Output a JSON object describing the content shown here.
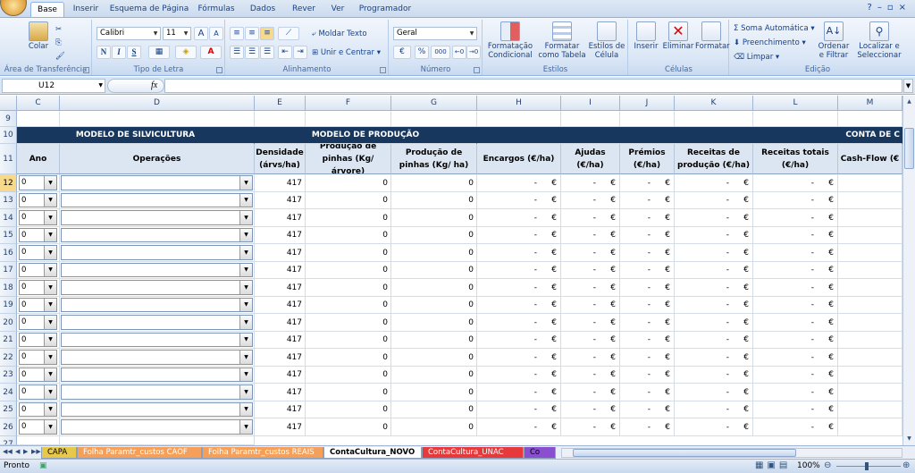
{
  "ribbon_tabs": [
    "Base",
    "Inserir",
    "Esquema de Página",
    "Fórmulas",
    "Dados",
    "Rever",
    "Ver",
    "Programador"
  ],
  "clipboard": {
    "paste_label": "Colar",
    "group_label": "Área de Transferência"
  },
  "font": {
    "name": "Calibri",
    "size": "11",
    "bold": "N",
    "italic": "I",
    "underline": "S",
    "grow": "A",
    "shrink": "A",
    "font_color": "A",
    "group_label": "Tipo de Letra"
  },
  "alignment": {
    "wrap_label": "Moldar Texto",
    "merge_label": "Unir e Centrar",
    "group_label": "Alinhamento"
  },
  "number": {
    "format": "Geral",
    "percent": "%",
    "thousands": "000",
    "group_label": "Número"
  },
  "styles": {
    "conditional_label": "Formatação Condicional",
    "table_label": "Formatar como Tabela",
    "cell_styles_label": "Estilos de Célula",
    "group_label": "Estilos"
  },
  "cells": {
    "insert_label": "Inserir",
    "delete_label": "Eliminar",
    "format_label": "Formatar",
    "group_label": "Células"
  },
  "editing": {
    "autosum_label": "Soma Automática",
    "fill_label": "Preenchimento",
    "clear_label": "Limpar",
    "sort_label": "Ordenar e Filtrar",
    "find_label": "Localizar e Seleccionar",
    "group_label": "Edição"
  },
  "formula_bar": {
    "name_box": "U12",
    "fx": "fx",
    "value": ""
  },
  "columns": [
    "C",
    "D",
    "E",
    "F",
    "G",
    "H",
    "I",
    "J",
    "K",
    "L",
    "M"
  ],
  "section_headers": {
    "silvicultura": "MODELO DE SILVICULTURA",
    "producao": "MODELO DE PRODUÇÃO",
    "conta": "CONTA DE C"
  },
  "table_headers": {
    "ano": "Ano",
    "operacoes": "Operações",
    "densidade": "Densidade (árvs/ha)",
    "prod_arvore": "Produção de pinhas (Kg/ árvore)",
    "prod_ha": "Produção de pinhas (Kg/ ha)",
    "encargos": "Encargos (€/ha)",
    "ajudas": "Ajudas (€/ha)",
    "premios": "Prémios (€/ha)",
    "receitas_prod": "Receitas de produção (€/ha)",
    "receitas_totais": "Receitas totais (€/ha)",
    "cashflow": "Cash-Flow (€"
  },
  "rows": [
    {
      "row": "12",
      "ano": "0",
      "operacao": "",
      "densidade": "417",
      "prod_arvore": "0",
      "prod_ha": "0",
      "dash": "-",
      "currency": "€"
    },
    {
      "row": "13",
      "ano": "0",
      "operacao": "",
      "densidade": "417",
      "prod_arvore": "0",
      "prod_ha": "0",
      "dash": "-",
      "currency": "€"
    },
    {
      "row": "14",
      "ano": "0",
      "operacao": "",
      "densidade": "417",
      "prod_arvore": "0",
      "prod_ha": "0",
      "dash": "-",
      "currency": "€"
    },
    {
      "row": "15",
      "ano": "0",
      "operacao": "",
      "densidade": "417",
      "prod_arvore": "0",
      "prod_ha": "0",
      "dash": "-",
      "currency": "€"
    },
    {
      "row": "16",
      "ano": "0",
      "operacao": "",
      "densidade": "417",
      "prod_arvore": "0",
      "prod_ha": "0",
      "dash": "-",
      "currency": "€"
    },
    {
      "row": "17",
      "ano": "0",
      "operacao": "",
      "densidade": "417",
      "prod_arvore": "0",
      "prod_ha": "0",
      "dash": "-",
      "currency": "€"
    },
    {
      "row": "18",
      "ano": "0",
      "operacao": "",
      "densidade": "417",
      "prod_arvore": "0",
      "prod_ha": "0",
      "dash": "-",
      "currency": "€"
    },
    {
      "row": "19",
      "ano": "0",
      "operacao": "",
      "densidade": "417",
      "prod_arvore": "0",
      "prod_ha": "0",
      "dash": "-",
      "currency": "€"
    },
    {
      "row": "20",
      "ano": "0",
      "operacao": "",
      "densidade": "417",
      "prod_arvore": "0",
      "prod_ha": "0",
      "dash": "-",
      "currency": "€"
    },
    {
      "row": "21",
      "ano": "0",
      "operacao": "",
      "densidade": "417",
      "prod_arvore": "0",
      "prod_ha": "0",
      "dash": "-",
      "currency": "€"
    },
    {
      "row": "22",
      "ano": "0",
      "operacao": "",
      "densidade": "417",
      "prod_arvore": "0",
      "prod_ha": "0",
      "dash": "-",
      "currency": "€"
    },
    {
      "row": "23",
      "ano": "0",
      "operacao": "",
      "densidade": "417",
      "prod_arvore": "0",
      "prod_ha": "0",
      "dash": "-",
      "currency": "€"
    },
    {
      "row": "24",
      "ano": "0",
      "operacao": "",
      "densidade": "417",
      "prod_arvore": "0",
      "prod_ha": "0",
      "dash": "-",
      "currency": "€"
    },
    {
      "row": "25",
      "ano": "0",
      "operacao": "",
      "densidade": "417",
      "prod_arvore": "0",
      "prod_ha": "0",
      "dash": "-",
      "currency": "€"
    },
    {
      "row": "26",
      "ano": "0",
      "operacao": "",
      "densidade": "417",
      "prod_arvore": "0",
      "prod_ha": "0",
      "dash": "-",
      "currency": "€"
    }
  ],
  "row_labels_top": [
    "9",
    "10",
    "11"
  ],
  "row_label_partial": "27",
  "sheet_tabs": [
    {
      "label": "CAPA",
      "color": "#e7c84b",
      "active": false
    },
    {
      "label": "Folha Paramtr_custos CAOF",
      "color": "#f4a05a",
      "active": false
    },
    {
      "label": "Folha Paramtr_custos REAIS",
      "color": "#f4a05a",
      "active": false
    },
    {
      "label": "ContaCultura_NOVO",
      "color": "#ffffff",
      "active": true
    },
    {
      "label": "ContaCultura_UNAC",
      "color": "#e5393b",
      "active": false
    },
    {
      "label": "Co",
      "color": "#8a4fd1",
      "active": false
    }
  ],
  "status": {
    "ready": "Pronto",
    "zoom": "100%"
  },
  "colors": {
    "navy_header": "#17375e",
    "header_fill": "#dce6f2",
    "selected_row": "#f8d98a"
  }
}
